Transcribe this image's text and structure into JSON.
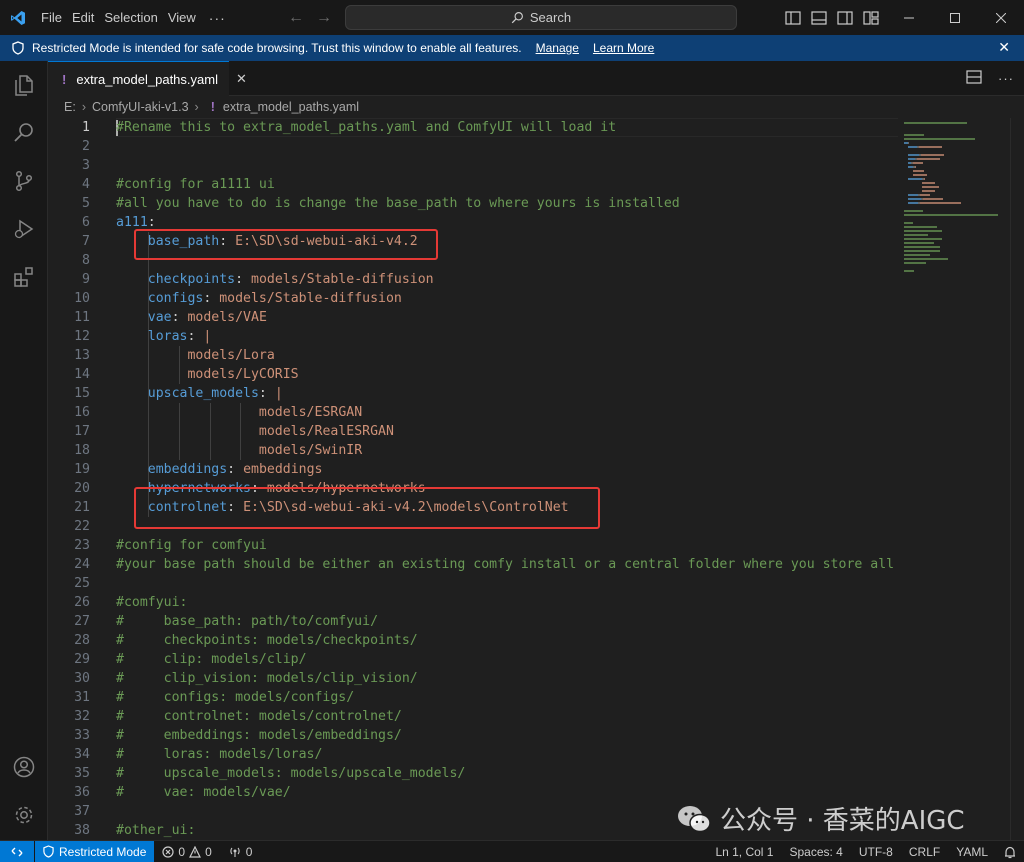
{
  "titlebar": {
    "menus": [
      "File",
      "Edit",
      "Selection",
      "View"
    ],
    "more": "···",
    "search_label": "Search"
  },
  "banner": {
    "message": "Restricted Mode is intended for safe code browsing. Trust this window to enable all features.",
    "manage_label": "Manage",
    "learn_more_label": "Learn More"
  },
  "tab": {
    "label": "extra_model_paths.yaml",
    "icon_text": "!"
  },
  "breadcrumb": {
    "drive": "E:",
    "folder": "ComfyUI-aki-v1.3",
    "file_icon": "!",
    "file": "extra_model_paths.yaml"
  },
  "editor": {
    "lines": [
      {
        "n": "1",
        "parts": [
          {
            "t": "#Rename this to extra_model_paths.yaml and ComfyUI will load it",
            "c": "com"
          }
        ]
      },
      {
        "n": "2",
        "parts": []
      },
      {
        "n": "3",
        "parts": []
      },
      {
        "n": "4",
        "parts": [
          {
            "t": "#config for a1111 ui",
            "c": "com"
          }
        ]
      },
      {
        "n": "5",
        "parts": [
          {
            "t": "#all you have to do is change the base_path to where yours is installed",
            "c": "com"
          }
        ]
      },
      {
        "n": "6",
        "parts": [
          {
            "t": "a111",
            "c": "key"
          },
          {
            "t": ":",
            "c": "pun"
          }
        ]
      },
      {
        "n": "7",
        "parts": [
          {
            "t": "    ",
            "c": "pun"
          },
          {
            "t": "base_path",
            "c": "key"
          },
          {
            "t": ": ",
            "c": "pun"
          },
          {
            "t": "E:\\SD\\sd-webui-aki-v4.2",
            "c": "str"
          }
        ]
      },
      {
        "n": "8",
        "parts": []
      },
      {
        "n": "9",
        "parts": [
          {
            "t": "    ",
            "c": "pun"
          },
          {
            "t": "checkpoints",
            "c": "key"
          },
          {
            "t": ": ",
            "c": "pun"
          },
          {
            "t": "models/Stable-diffusion",
            "c": "str"
          }
        ]
      },
      {
        "n": "10",
        "parts": [
          {
            "t": "    ",
            "c": "pun"
          },
          {
            "t": "configs",
            "c": "key"
          },
          {
            "t": ": ",
            "c": "pun"
          },
          {
            "t": "models/Stable-diffusion",
            "c": "str"
          }
        ]
      },
      {
        "n": "11",
        "parts": [
          {
            "t": "    ",
            "c": "pun"
          },
          {
            "t": "vae",
            "c": "key"
          },
          {
            "t": ": ",
            "c": "pun"
          },
          {
            "t": "models/VAE",
            "c": "str"
          }
        ]
      },
      {
        "n": "12",
        "parts": [
          {
            "t": "    ",
            "c": "pun"
          },
          {
            "t": "loras",
            "c": "key"
          },
          {
            "t": ": ",
            "c": "pun"
          },
          {
            "t": "|",
            "c": "str"
          }
        ]
      },
      {
        "n": "13",
        "parts": [
          {
            "t": "         ",
            "c": "pun"
          },
          {
            "t": "models/Lora",
            "c": "str"
          }
        ]
      },
      {
        "n": "14",
        "parts": [
          {
            "t": "         ",
            "c": "pun"
          },
          {
            "t": "models/LyCORIS",
            "c": "str"
          }
        ]
      },
      {
        "n": "15",
        "parts": [
          {
            "t": "    ",
            "c": "pun"
          },
          {
            "t": "upscale_models",
            "c": "key"
          },
          {
            "t": ": ",
            "c": "pun"
          },
          {
            "t": "|",
            "c": "str"
          }
        ]
      },
      {
        "n": "16",
        "parts": [
          {
            "t": "                  ",
            "c": "pun"
          },
          {
            "t": "models/ESRGAN",
            "c": "str"
          }
        ]
      },
      {
        "n": "17",
        "parts": [
          {
            "t": "                  ",
            "c": "pun"
          },
          {
            "t": "models/RealESRGAN",
            "c": "str"
          }
        ]
      },
      {
        "n": "18",
        "parts": [
          {
            "t": "                  ",
            "c": "pun"
          },
          {
            "t": "models/SwinIR",
            "c": "str"
          }
        ]
      },
      {
        "n": "19",
        "parts": [
          {
            "t": "    ",
            "c": "pun"
          },
          {
            "t": "embeddings",
            "c": "key"
          },
          {
            "t": ": ",
            "c": "pun"
          },
          {
            "t": "embeddings",
            "c": "str"
          }
        ]
      },
      {
        "n": "20",
        "parts": [
          {
            "t": "    ",
            "c": "pun"
          },
          {
            "t": "hypernetworks",
            "c": "key"
          },
          {
            "t": ": ",
            "c": "pun"
          },
          {
            "t": "models/hypernetworks",
            "c": "str"
          }
        ]
      },
      {
        "n": "21",
        "parts": [
          {
            "t": "    ",
            "c": "pun"
          },
          {
            "t": "controlnet",
            "c": "key"
          },
          {
            "t": ": ",
            "c": "pun"
          },
          {
            "t": "E:\\SD\\sd-webui-aki-v4.2\\models\\ControlNet",
            "c": "str"
          }
        ]
      },
      {
        "n": "22",
        "parts": []
      },
      {
        "n": "23",
        "parts": [
          {
            "t": "#config for comfyui",
            "c": "com"
          }
        ]
      },
      {
        "n": "24",
        "parts": [
          {
            "t": "#your base path should be either an existing comfy install or a central folder where you store all of",
            "c": "com"
          }
        ]
      },
      {
        "n": "25",
        "parts": []
      },
      {
        "n": "26",
        "parts": [
          {
            "t": "#comfyui:",
            "c": "com"
          }
        ]
      },
      {
        "n": "27",
        "parts": [
          {
            "t": "#     base_path: path/to/comfyui/",
            "c": "com"
          }
        ]
      },
      {
        "n": "28",
        "parts": [
          {
            "t": "#     checkpoints: models/checkpoints/",
            "c": "com"
          }
        ]
      },
      {
        "n": "29",
        "parts": [
          {
            "t": "#     clip: models/clip/",
            "c": "com"
          }
        ]
      },
      {
        "n": "30",
        "parts": [
          {
            "t": "#     clip_vision: models/clip_vision/",
            "c": "com"
          }
        ]
      },
      {
        "n": "31",
        "parts": [
          {
            "t": "#     configs: models/configs/",
            "c": "com"
          }
        ]
      },
      {
        "n": "32",
        "parts": [
          {
            "t": "#     controlnet: models/controlnet/",
            "c": "com"
          }
        ]
      },
      {
        "n": "33",
        "parts": [
          {
            "t": "#     embeddings: models/embeddings/",
            "c": "com"
          }
        ]
      },
      {
        "n": "34",
        "parts": [
          {
            "t": "#     loras: models/loras/",
            "c": "com"
          }
        ]
      },
      {
        "n": "35",
        "parts": [
          {
            "t": "#     upscale_models: models/upscale_models/",
            "c": "com"
          }
        ]
      },
      {
        "n": "36",
        "parts": [
          {
            "t": "#     vae: models/vae/",
            "c": "com"
          }
        ]
      },
      {
        "n": "37",
        "parts": []
      },
      {
        "n": "38",
        "parts": [
          {
            "t": "#other_ui:",
            "c": "com"
          }
        ]
      }
    ]
  },
  "statusbar": {
    "restricted_label": "Restricted Mode",
    "errors": "0",
    "warnings": "0",
    "ports": "0",
    "position": "Ln 1, Col 1",
    "spaces": "Spaces: 4",
    "encoding": "UTF-8",
    "eol": "CRLF",
    "language": "YAML"
  },
  "watermark": {
    "text": "公众号 · 香菜的AIGC"
  },
  "colors": {
    "accent": "#0078d4",
    "banner": "#0e4075",
    "comment": "#6a9955",
    "key": "#569cd6",
    "string": "#ce9178",
    "highlight": "#e53935"
  }
}
